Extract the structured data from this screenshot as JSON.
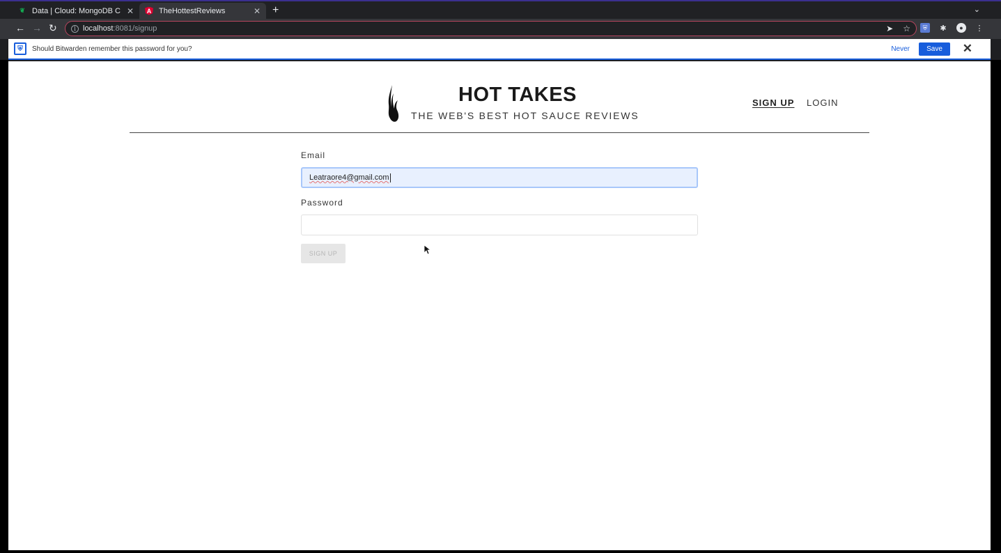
{
  "browser": {
    "tabs": [
      {
        "label": "Data | Cloud: MongoDB C",
        "icon": "mongodb-leaf-icon"
      },
      {
        "label": "TheHottestReviews",
        "icon": "angular-icon"
      }
    ],
    "url_host": "localhost",
    "url_path": ":8081/signup"
  },
  "bitwarden": {
    "message": "Should Bitwarden remember this password for you?",
    "never_label": "Never",
    "save_label": "Save"
  },
  "site": {
    "title": "HOT TAKES",
    "subtitle": "THE WEB'S BEST HOT SAUCE REVIEWS",
    "nav": {
      "signup": "SIGN UP",
      "login": "LOGIN"
    }
  },
  "form": {
    "email_label": "Email",
    "email_value": "Leatraore4@gmail.com",
    "password_label": "Password",
    "password_value": "",
    "submit_label": "SIGN UP"
  },
  "colors": {
    "bitwarden_blue": "#175ddc",
    "autofill_bg": "#e8f0fe",
    "omnibox_border": "#b8465f"
  }
}
